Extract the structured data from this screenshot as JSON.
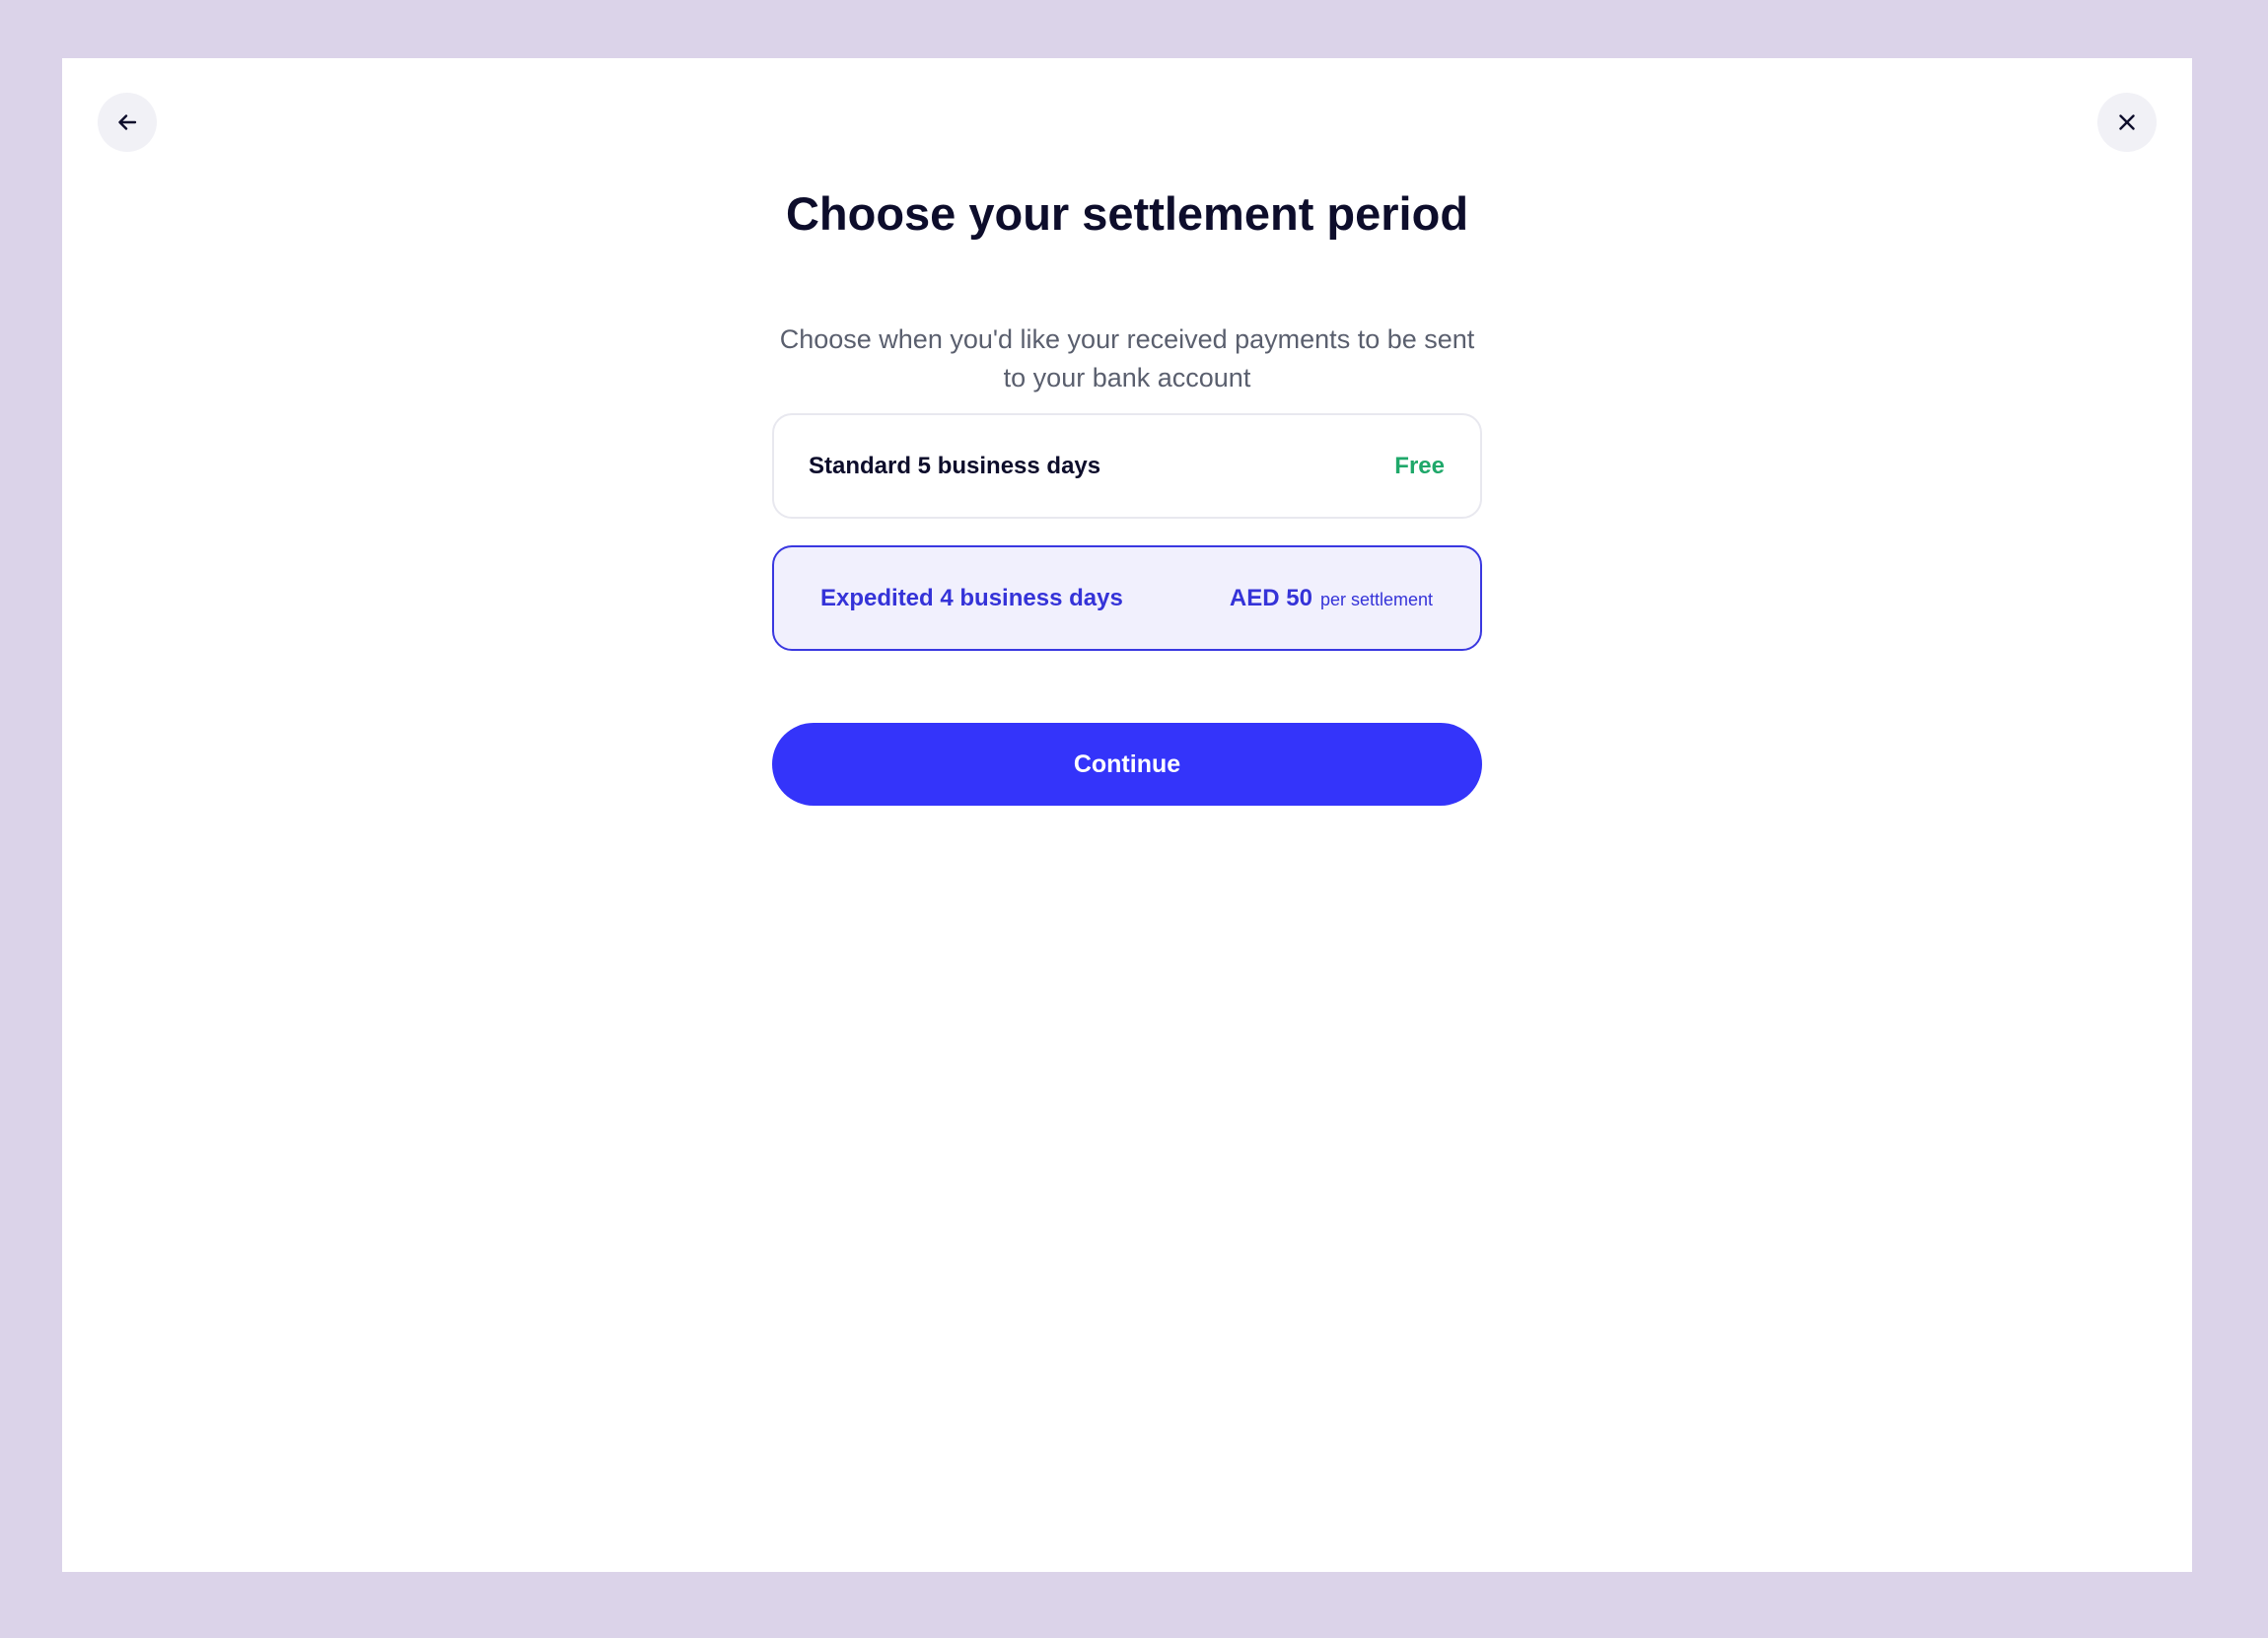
{
  "modal": {
    "title": "Choose your settlement period",
    "subtitle": "Choose when you'd like your received payments to be sent to your bank account",
    "back_icon": "arrow-left-icon",
    "close_icon": "close-icon"
  },
  "options": [
    {
      "label": "Standard 5 business days",
      "price": "Free",
      "selected": false
    },
    {
      "label": "Expedited 4 business days",
      "price": "AED 50",
      "price_unit": "per settlement",
      "selected": true
    }
  ],
  "continue_label": "Continue",
  "colors": {
    "backdrop": "#dbd3e9",
    "accent": "#3434fa",
    "selected_text": "#3533d8",
    "free_green": "#1fa86a",
    "title": "#0d0d2b"
  }
}
